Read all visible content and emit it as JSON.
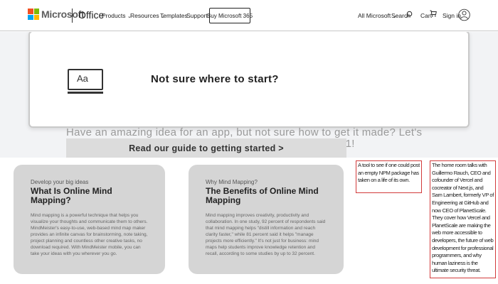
{
  "header": {
    "brand": "Microsoft",
    "product": "Office",
    "nav": [
      {
        "label": "Products",
        "has_chevron": true
      },
      {
        "label": "Resources",
        "has_chevron": true
      },
      {
        "label": "Templates",
        "has_chevron": false
      },
      {
        "label": "Support",
        "has_chevron": false
      }
    ],
    "buy_label": "Buy Microsoft 365",
    "all_microsoft": "All Microsoft",
    "search": "Search",
    "cart": "Cart",
    "sign_in": "Sign in"
  },
  "guide": {
    "icon_text": "Aa",
    "title": "Not sure where to start?",
    "description": "Have an amazing idea for an app, but not sure how to get it made? Let's compare the top 7 strategies for app development in 2021!",
    "button": "Read our guide to getting started >"
  },
  "cards": [
    {
      "eyebrow": "Develop your big ideas",
      "title": "What Is Online Mind Mapping?",
      "body": "Mind mapping is a powerful technique that helps you visualize your thoughts and communicate them to others. MindMeister's easy-to-use, web-based mind map maker provides an infinite canvas for brainstorming, note taking, project planning and countless other creative tasks, no download required. With MindMeister mobile, you can take your ideas with you wherever you go."
    },
    {
      "eyebrow": "Why Mind Mapping?",
      "title": "The Benefits of Online Mind Mapping",
      "body": "Mind mapping improves creativity, productivity and collaboration. In one study, 92 percent of respondents said that mind mapping helps \"distill information and reach clarity faster,\" while 81 percent said it helps \"manage projects more efficiently.\" It's not just for business: mind maps help students improve knowledge retention and recall, according to some studies by up to 32 percent."
    }
  ],
  "notes": [
    "A tool to see if one could post an empty NPM package has taken on a life of its own.",
    "The home room talks with Guillermo Rauch, CEO and cofounder of Vercel and cocreator of Next.js, and Sam Lambert, formerly VP of Engineering at GitHub and now CEO of PlanetScale. They cover how Vercel and PlanetScale are making the web more accessible to developers, the future of web development for professional programmers, and why human laziness is the ultimate security threat."
  ],
  "colors": {
    "ms_red": "#f25022",
    "ms_green": "#7fba00",
    "ms_blue": "#00a4ef",
    "ms_yellow": "#ffb900",
    "note_border": "#d23b3b"
  }
}
